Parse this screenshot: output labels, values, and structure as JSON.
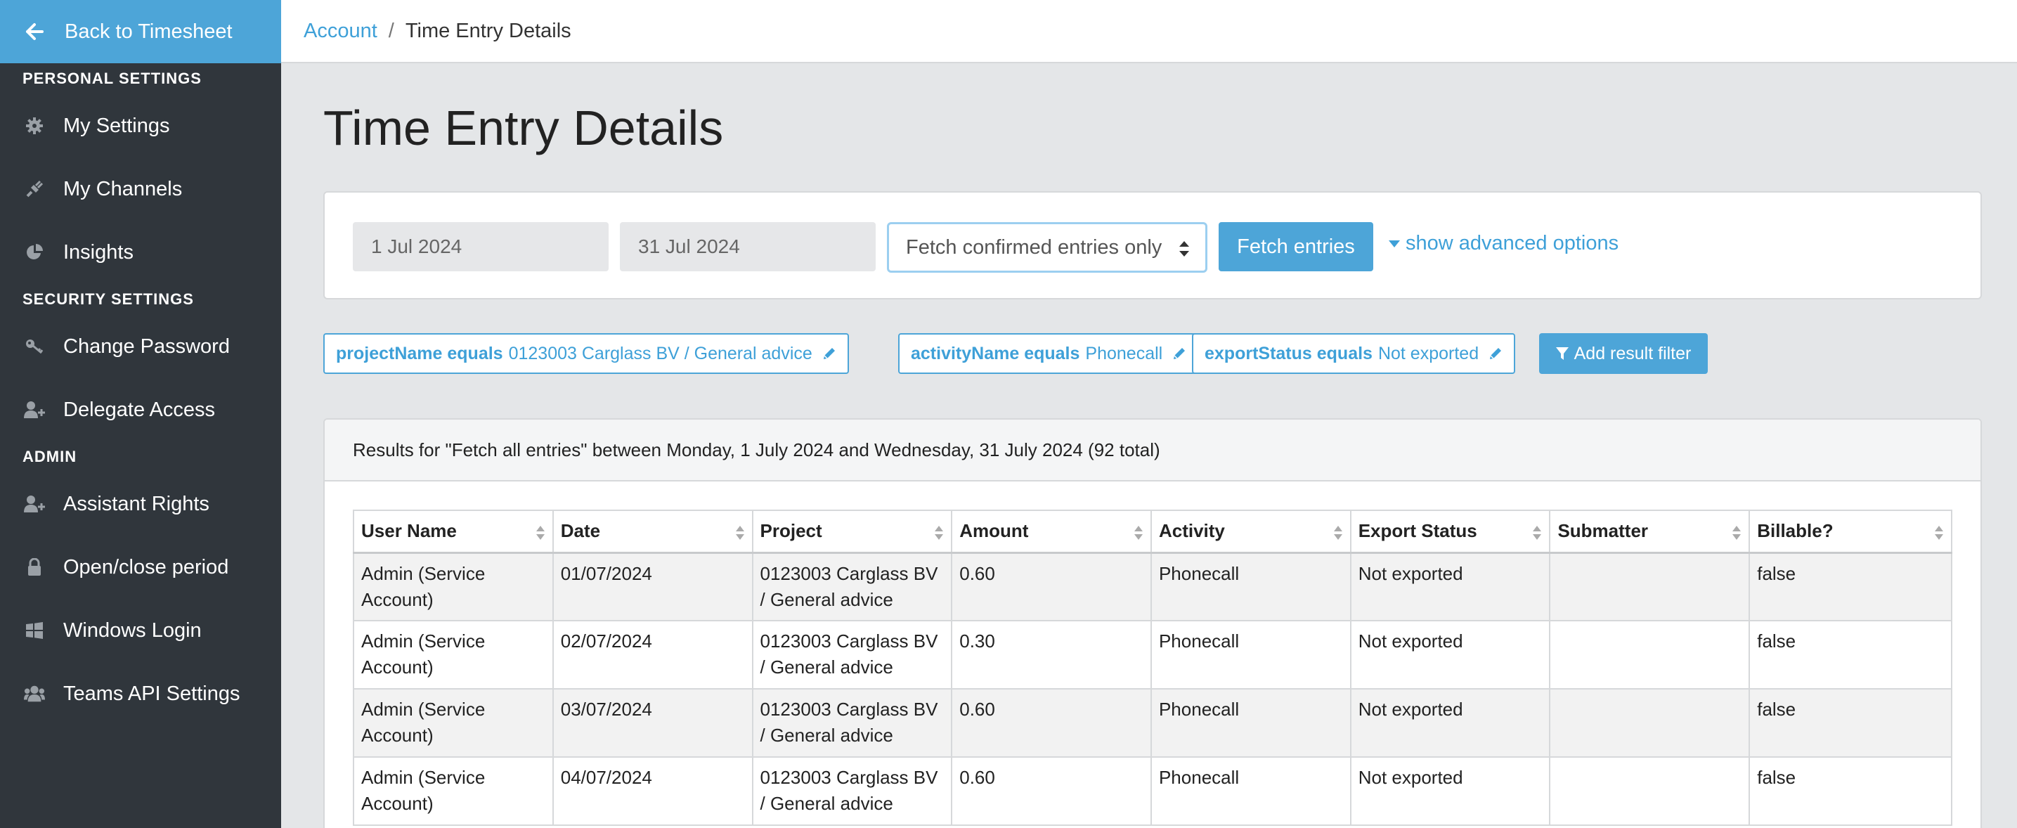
{
  "sidebar": {
    "back_label": "Back to Timesheet",
    "sections": [
      {
        "title": "PERSONAL SETTINGS",
        "items": [
          {
            "label": "My Settings",
            "icon": "gear-icon"
          },
          {
            "label": "My Channels",
            "icon": "plug-icon"
          },
          {
            "label": "Insights",
            "icon": "pie-chart-icon"
          }
        ]
      },
      {
        "title": "SECURITY SETTINGS",
        "items": [
          {
            "label": "Change Password",
            "icon": "key-icon"
          },
          {
            "label": "Delegate Access",
            "icon": "user-plus-icon"
          }
        ]
      },
      {
        "title": "ADMIN",
        "items": [
          {
            "label": "Assistant Rights",
            "icon": "user-plus-icon"
          },
          {
            "label": "Open/close period",
            "icon": "lock-icon"
          },
          {
            "label": "Windows Login",
            "icon": "windows-icon"
          },
          {
            "label": "Teams API Settings",
            "icon": "users-icon"
          }
        ]
      }
    ]
  },
  "breadcrumb": {
    "parent": "Account",
    "separator": "/",
    "current": "Time Entry Details"
  },
  "page": {
    "title": "Time Entry Details"
  },
  "filters": {
    "start_date": "1 Jul 2024",
    "end_date": "31 Jul 2024",
    "fetch_mode": "Fetch confirmed entries only",
    "fetch_button": "Fetch entries",
    "advanced_link": "show advanced options"
  },
  "result_filters": [
    {
      "field": "projectName equals",
      "value": "0123003 Carglass BV / General advice"
    },
    {
      "field": "activityName equals",
      "value": "Phonecall"
    },
    {
      "field": "exportStatus equals",
      "value": "Not exported"
    }
  ],
  "add_filter_label": "Add result filter",
  "results": {
    "summary": "Results for \"Fetch all entries\" between Monday, 1 July 2024 and Wednesday, 31 July 2024 (92 total)",
    "columns": [
      "User Name",
      "Date",
      "Project",
      "Amount",
      "Activity",
      "Export Status",
      "Submatter",
      "Billable?"
    ],
    "rows": [
      {
        "user": "Admin (Service Account)",
        "date": "01/07/2024",
        "project": "0123003 Carglass BV / General advice",
        "amount": "0.60",
        "activity": "Phonecall",
        "export_status": "Not exported",
        "submatter": "",
        "billable": "false"
      },
      {
        "user": "Admin (Service Account)",
        "date": "02/07/2024",
        "project": "0123003 Carglass BV / General advice",
        "amount": "0.30",
        "activity": "Phonecall",
        "export_status": "Not exported",
        "submatter": "",
        "billable": "false"
      },
      {
        "user": "Admin (Service Account)",
        "date": "03/07/2024",
        "project": "0123003 Carglass BV / General advice",
        "amount": "0.60",
        "activity": "Phonecall",
        "export_status": "Not exported",
        "submatter": "",
        "billable": "false"
      },
      {
        "user": "Admin (Service Account)",
        "date": "04/07/2024",
        "project": "0123003 Carglass BV / General advice",
        "amount": "0.60",
        "activity": "Phonecall",
        "export_status": "Not exported",
        "submatter": "",
        "billable": "false"
      }
    ]
  },
  "colors": {
    "accent": "#4da5d8",
    "sidebar_bg": "#30363c",
    "page_bg": "#e4e6e8"
  }
}
